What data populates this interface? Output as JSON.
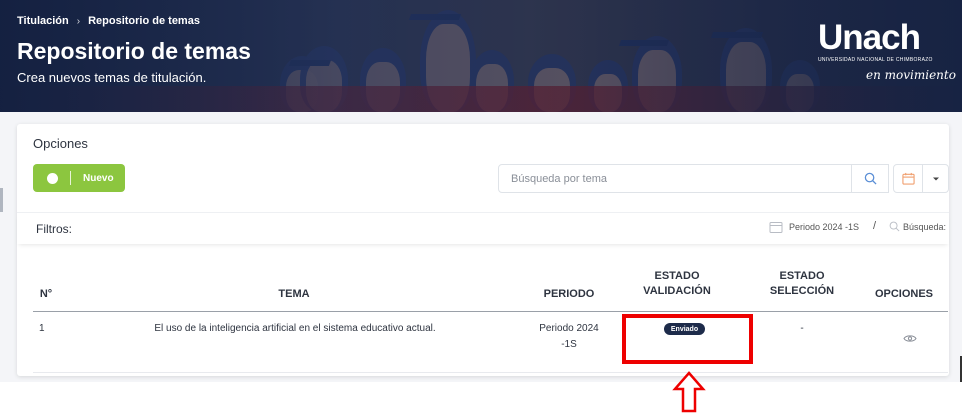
{
  "breadcrumb": {
    "item1": "Titulación",
    "separator": "›",
    "item2": "Repositorio de temas"
  },
  "header": {
    "title": "Repositorio de temas",
    "subtitle": "Crea nuevos temas de titulación."
  },
  "logo": {
    "main": "Unach",
    "small": "UNIVERSIDAD NACIONAL DE CHIMBORAZO",
    "tagline": "en movimiento"
  },
  "options": {
    "label": "Opciones",
    "new_button": "Nuevo",
    "search_placeholder": "Búsqueda por tema"
  },
  "filters": {
    "label": "Filtros:",
    "periodo": "Periodo 2024 -1S",
    "slash": "/",
    "busqueda": "Búsqueda:"
  },
  "table": {
    "headers": {
      "n": "N°",
      "tema": "TEMA",
      "periodo": "PERIODO",
      "estado_validacion_1": "ESTADO",
      "estado_validacion_2": "VALIDACIÓN",
      "estado_seleccion_1": "ESTADO",
      "estado_seleccion_2": "SELECCIÓN",
      "opciones": "OPCIONES"
    },
    "rows": [
      {
        "n": "1",
        "tema": "El uso de la inteligencia artificial en el sistema educativo actual.",
        "periodo_1": "Periodo 2024",
        "periodo_2": "-1S",
        "estado_validacion": "Enviado",
        "estado_seleccion": "-"
      }
    ]
  },
  "colors": {
    "accent_green": "#8cc63f",
    "badge_navy": "#1d2b4a",
    "highlight_red": "#ee0000",
    "banner_navy": "#1b2a4c"
  },
  "icons": {
    "search": "search-icon",
    "calendar": "calendar-icon",
    "dropdown": "caret-down-icon",
    "view": "eye-icon",
    "arrow": "arrow-up-icon"
  }
}
